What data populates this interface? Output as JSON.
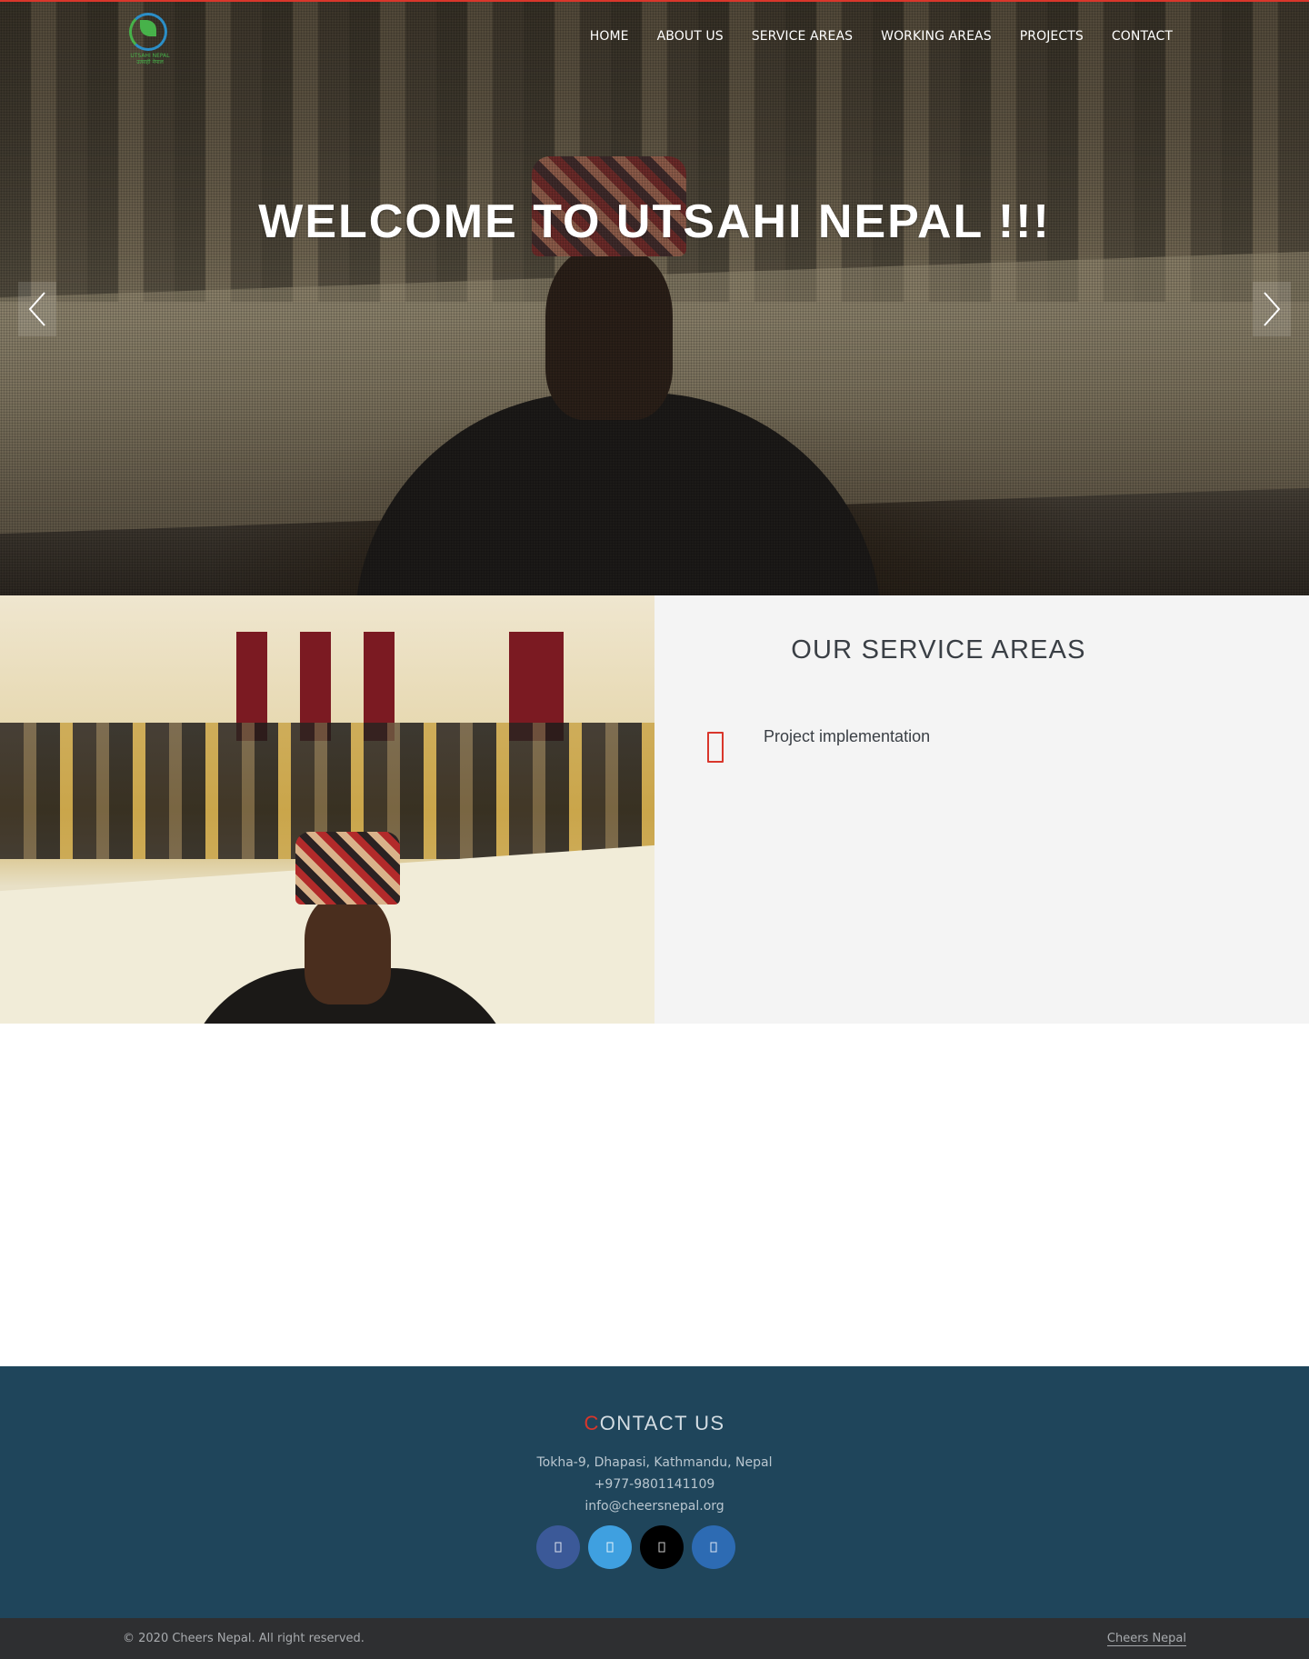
{
  "header": {
    "logo_text_en": "UTSAHI NEPAL",
    "logo_text_np": "उत्साही नेपाल",
    "nav": [
      {
        "label": "HOME"
      },
      {
        "label": "ABOUT US"
      },
      {
        "label": "SERVICE AREAS"
      },
      {
        "label": "WORKING AREAS"
      },
      {
        "label": "PROJECTS"
      },
      {
        "label": "CONTACT"
      }
    ]
  },
  "hero": {
    "title": "WELCOME TO UTSAHI NEPAL !!!",
    "prev_icon": "chevron-left-icon",
    "next_icon": "chevron-right-icon"
  },
  "services": {
    "heading": "OUR SERVICE AREAS",
    "items": [
      {
        "label": "Project implementation",
        "icon": "document-icon",
        "icon_color": "#d9362b"
      }
    ]
  },
  "contact": {
    "heading_first": "C",
    "heading_rest": "ONTACT US",
    "address": "Tokha-9, Dhapasi, Kathmandu, Nepal",
    "phone": "+977-9801141109",
    "email": "info@cheersnepal.org",
    "socials": [
      {
        "icon": "facebook-icon",
        "color": "#3b5998"
      },
      {
        "icon": "twitter-icon",
        "color": "#3fa0e0"
      },
      {
        "icon": "github-icon",
        "color": "#000000"
      },
      {
        "icon": "linkedin-icon",
        "color": "#2d6bb3"
      }
    ]
  },
  "footer": {
    "copyright": "© 2020 Cheers Nepal. All right reserved.",
    "brand_link": "Cheers Nepal"
  },
  "colors": {
    "accent": "#d9362b",
    "footer_bg": "#1f455b",
    "bottom_bar_bg": "#2e2f31",
    "service_bg": "#f4f4f4"
  }
}
